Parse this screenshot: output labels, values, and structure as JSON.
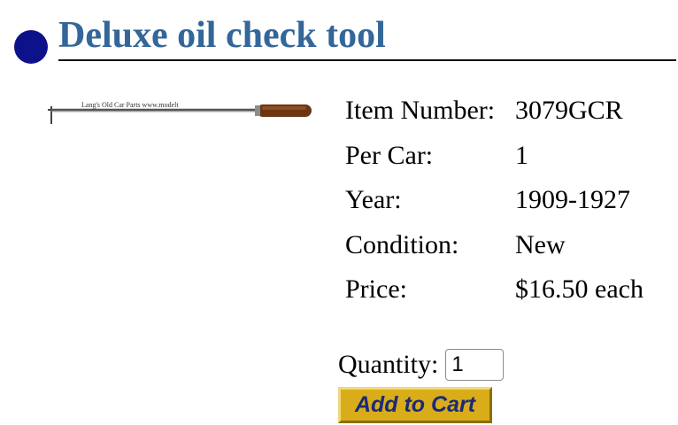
{
  "product": {
    "title": "Deluxe oil check tool",
    "image_caption_text": "Lang's Old Car Parts www.modelt",
    "details": [
      {
        "label": "Item Number:",
        "value": "3079GCR"
      },
      {
        "label": "Per Car:",
        "value": "1"
      },
      {
        "label": "Year:",
        "value": "1909-1927"
      },
      {
        "label": "Condition:",
        "value": "New"
      },
      {
        "label": "Price:",
        "value": "$16.50 each"
      }
    ]
  },
  "order": {
    "quantity_label": "Quantity:",
    "quantity_value": "1",
    "add_to_cart_label": "Add to Cart"
  },
  "colors": {
    "title": "#336699",
    "bullet": "#0e128a",
    "button": "#d9ad1a",
    "button_text": "#1a2a7a"
  },
  "icons": {
    "bullet": "bullet-icon"
  }
}
